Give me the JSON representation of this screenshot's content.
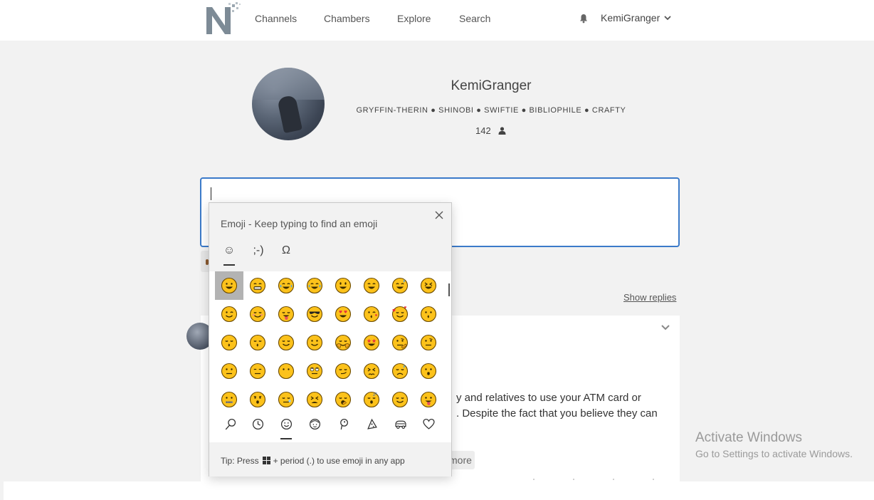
{
  "nav": {
    "logo_text": "N",
    "links": [
      "Channels",
      "Chambers",
      "Explore",
      "Search"
    ],
    "user_name": "KemiGranger",
    "icons": {
      "notification": "bell-icon",
      "menu": "chevron-down-icon"
    }
  },
  "profile": {
    "name": "KemiGranger",
    "tags": "GRYFFIN-THERIN ● SHINOBI ● SWIFTIE ● BIBLIOPHILE ● CRAFTY",
    "followers": "142",
    "followers_icon": "person-icon"
  },
  "composer": {
    "value": ""
  },
  "thread": {
    "show_replies": "Show replies",
    "post_line_1": "y and relatives to use your ATM card or",
    "post_line_2": ". Despite the fact that you believe they can",
    "more_label": "more"
  },
  "emoji_panel": {
    "title": "Emoji - Keep typing to find an emoji",
    "mode_tabs": [
      "☺",
      ";-)",
      "Ω"
    ],
    "tip_prefix": "Tip: Press",
    "tip_suffix": "+ period (.) to use emoji in any app",
    "grid": [
      [
        "grinning",
        "grin",
        "joy",
        "rofl",
        "smiley",
        "smile",
        "sweat-smile",
        "laughing"
      ],
      [
        "wink",
        "blush",
        "yum",
        "sunglasses",
        "heart-eyes",
        "kissing-heart",
        "smiling-hearts",
        "kissing"
      ],
      [
        "kissing-smiling",
        "kissing-closed-eyes",
        "relaxed",
        "slight-smile",
        "hugging",
        "star-struck",
        "thinking",
        "raised-eyebrow"
      ],
      [
        "neutral",
        "expressionless",
        "no-mouth",
        "rolling-eyes",
        "smirk",
        "persevere",
        "disappointed-relieved",
        "open-mouth"
      ],
      [
        "zipper-mouth",
        "hushed",
        "sleepy",
        "tired",
        "yawning",
        "sleeping",
        "relieved",
        "tongue"
      ]
    ],
    "categories": [
      "search-icon",
      "recent-icon",
      "smiley-icon",
      "people-icon",
      "celebration-icon",
      "food-icon",
      "travel-icon",
      "heart-icon"
    ],
    "accent": "#fcc21b"
  },
  "watermark": {
    "title": "Activate Windows",
    "subtitle": "Go to Settings to activate Windows."
  }
}
